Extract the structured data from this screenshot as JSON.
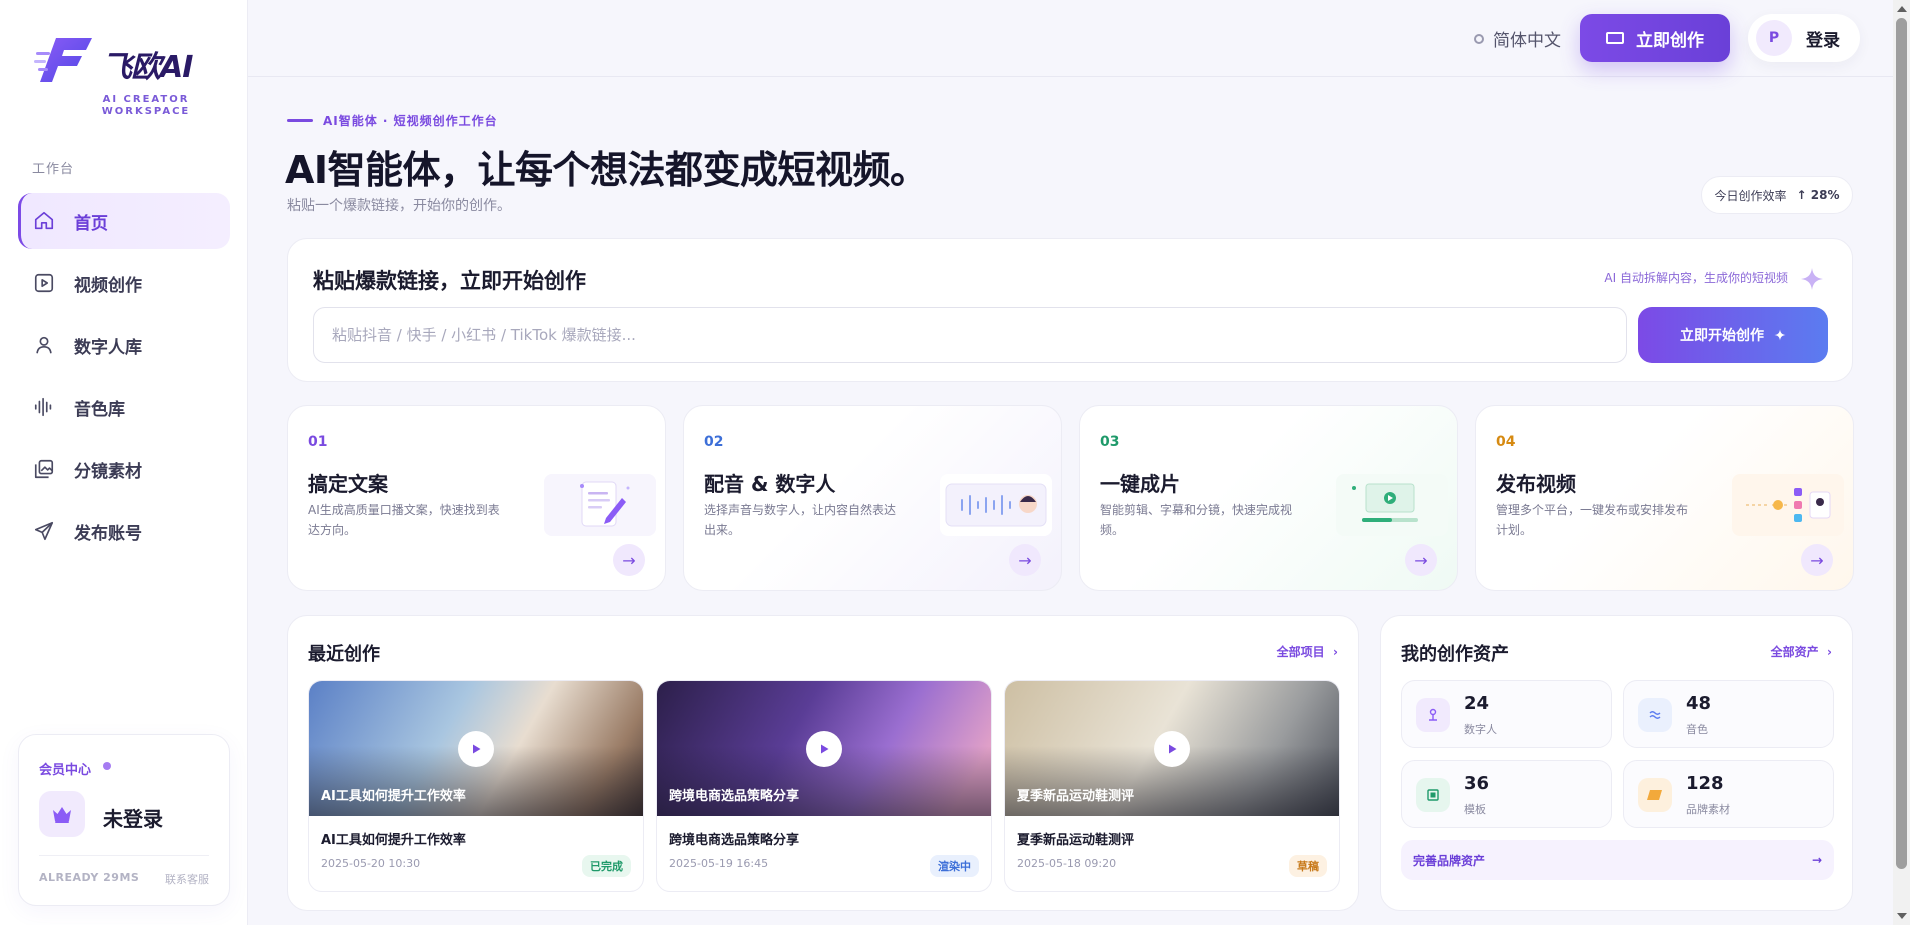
{
  "brand": {
    "name": "飞欧AI",
    "subtitle_line1": "AI CREATOR",
    "subtitle_line2": "WORKSPACE"
  },
  "sidebar": {
    "section_label": "工作台",
    "items": [
      {
        "label": "首页",
        "icon": "home-icon",
        "active": true
      },
      {
        "label": "视频创作",
        "icon": "video-play-icon",
        "active": false
      },
      {
        "label": "数字人库",
        "icon": "user-icon",
        "active": false
      },
      {
        "label": "音色库",
        "icon": "waveform-icon",
        "active": false
      },
      {
        "label": "分镜素材",
        "icon": "image-stack-icon",
        "active": false
      },
      {
        "label": "发布账号",
        "icon": "send-icon",
        "active": false
      }
    ],
    "member": {
      "title": "会员中心",
      "status": "未登录",
      "footer_left": "ALREADY  29MS",
      "footer_right": "联系客服"
    }
  },
  "topbar": {
    "language": "简体中文",
    "create_button": "立即创作",
    "login_avatar": "P",
    "login_button": "登录"
  },
  "hero": {
    "eyebrow": "AI智能体 · 短视频创作工作台",
    "title": "AI智能体，让每个想法都变成短视频。",
    "subtitle": "粘贴一个爆款链接，开始你的创作。",
    "efficiency_label": "今日创作效率",
    "efficiency_value": "↑ 28%"
  },
  "paste": {
    "title": "粘贴爆款链接，立即开始创作",
    "hint": "AI 自动拆解内容，生成你的短视频",
    "placeholder": "粘贴抖音 / 快手 / 小红书 / TikTok 爆款链接...",
    "value": "",
    "button": "立即开始创作"
  },
  "steps": [
    {
      "num": "01",
      "title": "搞定文案",
      "desc": "AI生成高质量口播文案，快速找到表达方向。",
      "color": "#7a4ae0"
    },
    {
      "num": "02",
      "title": "配音 & 数字人",
      "desc": "选择声音与数字人，让内容自然表达出来。",
      "color": "#3d6fd8"
    },
    {
      "num": "03",
      "title": "一键成片",
      "desc": "智能剪辑、字幕和分镜，快速完成视频。",
      "color": "#1f9a6a"
    },
    {
      "num": "04",
      "title": "发布视频",
      "desc": "管理多个平台，一键发布或安排发布计划。",
      "color": "#d68a12"
    }
  ],
  "recent": {
    "title": "最近创作",
    "link": "全部项目",
    "videos": [
      {
        "caption": "AI工具如何提升工作效率",
        "title": "AI工具如何提升工作效率",
        "date": "2025-05-20 10:30",
        "status": "已完成"
      },
      {
        "caption": "跨境电商选品策略分享",
        "title": "跨境电商选品策略分享",
        "date": "2025-05-19 16:45",
        "status": "渲染中"
      },
      {
        "caption": "夏季新品运动鞋测评",
        "title": "夏季新品运动鞋测评",
        "date": "2025-05-18 09:20",
        "status": "草稿"
      }
    ]
  },
  "assets": {
    "title": "我的创作资产",
    "link": "全部资产",
    "items": [
      {
        "count": "24",
        "label": "数字人",
        "icon": "person-pin-icon"
      },
      {
        "count": "48",
        "label": "音色",
        "icon": "wave-icon"
      },
      {
        "count": "36",
        "label": "模板",
        "icon": "template-icon"
      },
      {
        "count": "128",
        "label": "品牌素材",
        "icon": "brand-tag-icon"
      }
    ],
    "brand_row": "完善品牌资产"
  },
  "colors": {
    "accent": "#7c4ae6",
    "accent_blue": "#5b7cf0",
    "status_done": "#1f9a6a",
    "status_rendering": "#3d6fd8",
    "status_draft": "#c7791a"
  }
}
